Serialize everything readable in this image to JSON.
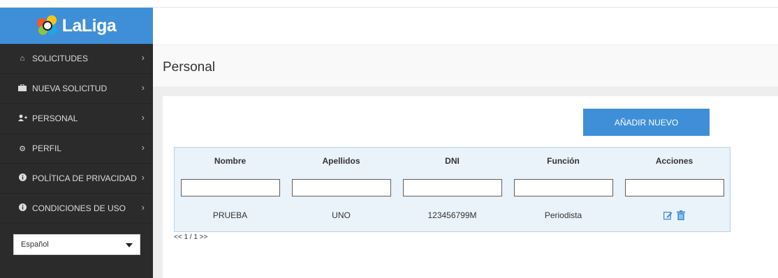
{
  "brand": {
    "name": "LaLiga"
  },
  "sidebar": {
    "items": [
      {
        "label": "SOLICITUDES",
        "icon": "home-icon"
      },
      {
        "label": "NUEVA SOLICITUD",
        "icon": "briefcase-icon"
      },
      {
        "label": "PERSONAL",
        "icon": "add-user-icon"
      },
      {
        "label": "PERFIL",
        "icon": "gears-icon"
      },
      {
        "label": "POLÍTICA DE PRIVACIDAD",
        "icon": "info-icon"
      },
      {
        "label": "CONDICIONES DE USO",
        "icon": "info-icon"
      }
    ],
    "language": {
      "selected": "Español"
    }
  },
  "page": {
    "title": "Personal"
  },
  "toolbar": {
    "add_label": "AÑADIR NUEVO"
  },
  "table": {
    "columns": [
      "Nombre",
      "Apellidos",
      "DNI",
      "Función",
      "Acciones"
    ],
    "rows": [
      {
        "nombre": "PRUEBA",
        "apellidos": "UNO",
        "dni": "123456799M",
        "funcion": "Periodista"
      }
    ],
    "pagination": "<< 1 / 1 >>"
  },
  "colors": {
    "accent": "#3f8fd8",
    "sidebar_bg": "#2b2b2b",
    "table_bg": "#eaf2fa",
    "table_border": "#b7d2e8"
  }
}
